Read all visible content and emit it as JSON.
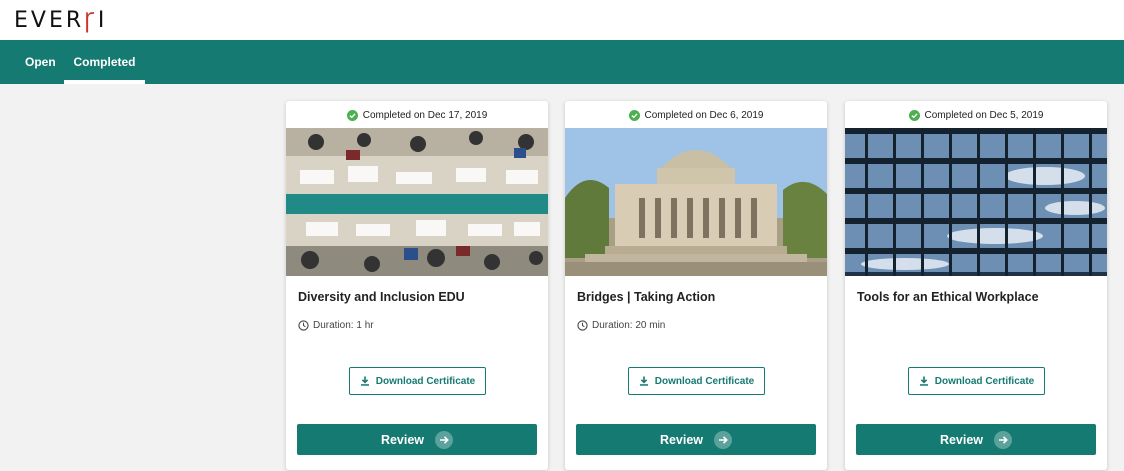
{
  "brand": {
    "logo_pre": "EVER",
    "logo_mark": "ꜰ",
    "logo_post": "I"
  },
  "nav": {
    "tabs": [
      {
        "label": "Open"
      },
      {
        "label": "Completed",
        "active": true
      }
    ]
  },
  "colors": {
    "accent": "#157a71",
    "check": "#4caf50",
    "brand_red": "#c8362b"
  },
  "cards": [
    {
      "status": "Completed on Dec 17, 2019",
      "title": "Diversity and Inclusion EDU",
      "duration": "Duration: 1 hr",
      "download_label": "Download Certificate",
      "review_label": "Review"
    },
    {
      "status": "Completed on Dec 6, 2019",
      "title": "Bridges | Taking Action",
      "duration": "Duration: 20 min",
      "download_label": "Download Certificate",
      "review_label": "Review"
    },
    {
      "status": "Completed on Dec 5, 2019",
      "title": "Tools for an Ethical Workplace",
      "duration": "",
      "download_label": "Download Certificate",
      "review_label": "Review"
    }
  ]
}
